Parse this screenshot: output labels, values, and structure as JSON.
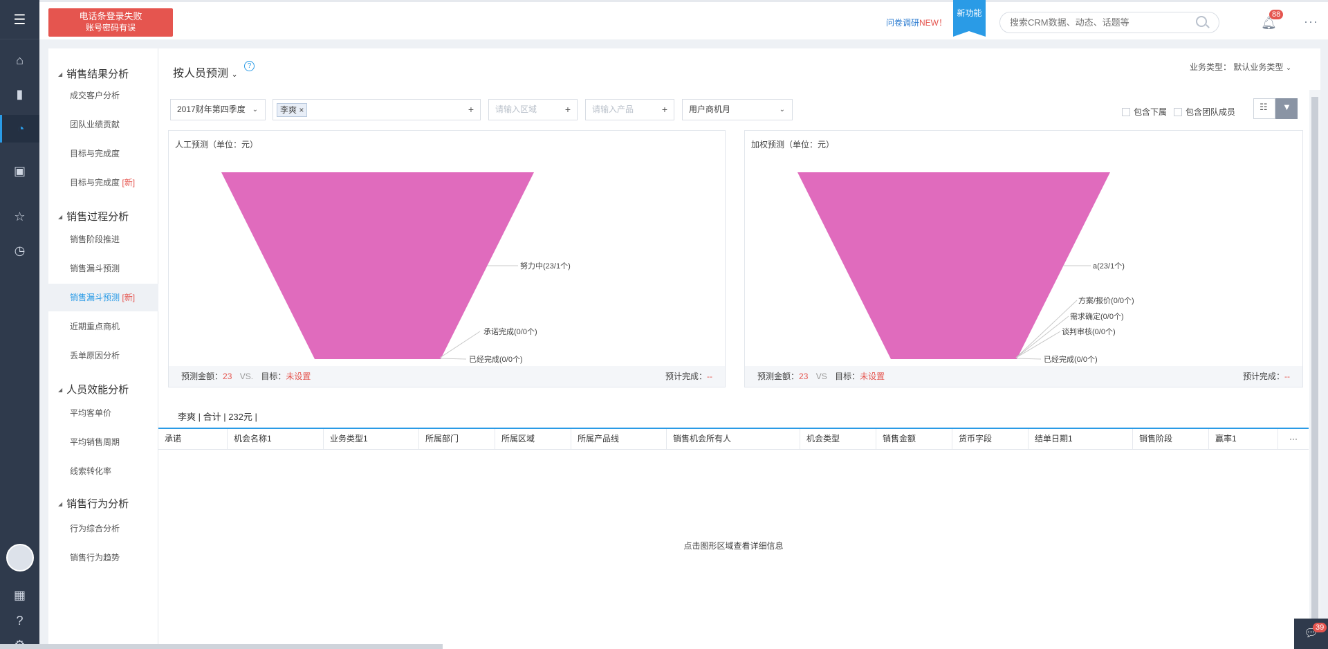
{
  "rail": {
    "icons": [
      "menu-icon",
      "home-icon",
      "bar-chart-icon",
      "pie-chart-icon",
      "monitor-icon",
      "star-icon",
      "history-icon",
      "grid-icon",
      "help-icon",
      "gear-icon"
    ]
  },
  "topbar": {
    "alert_line1": "电话条登录失败",
    "alert_line2": "账号密码有误",
    "survey": "问卷调研",
    "survey_new": "NEW！",
    "new_feature": "新功能",
    "search_placeholder": "搜索CRM数据、动态、话题等",
    "notifications": "88",
    "more": "···"
  },
  "sidebar": {
    "groups": [
      {
        "label": "销售结果分析",
        "items": [
          {
            "label": "成交客户分析"
          },
          {
            "label": "团队业绩贡献"
          },
          {
            "label": "目标与完成度"
          },
          {
            "label": "目标与完成度",
            "tag": "[新]"
          }
        ]
      },
      {
        "label": "销售过程分析",
        "items": [
          {
            "label": "销售阶段推进"
          },
          {
            "label": "销售漏斗预测"
          },
          {
            "label": "销售漏斗预测",
            "tag": "[新]",
            "active": true
          },
          {
            "label": "近期重点商机"
          },
          {
            "label": "丢单原因分析"
          }
        ]
      },
      {
        "label": "人员效能分析",
        "items": [
          {
            "label": "平均客单价"
          },
          {
            "label": "平均销售周期"
          },
          {
            "label": "线索转化率"
          }
        ]
      },
      {
        "label": "销售行为分析",
        "items": [
          {
            "label": "行为综合分析"
          },
          {
            "label": "销售行为趋势"
          }
        ]
      }
    ]
  },
  "main": {
    "title": "按人员预测",
    "biz_type_label": "业务类型：",
    "biz_type_value": "默认业务类型",
    "filters": {
      "period": "2017财年第四季度",
      "person_chip": "李爽",
      "region_placeholder": "请输入区域",
      "product_placeholder": "请输入产品",
      "month_mode": "用户商机月"
    },
    "checkboxes": {
      "include_sub": "包含下属",
      "include_team": "包含团队成员"
    },
    "panels": [
      {
        "title": "人工预测（单位：元）",
        "labels": [
          "努力中(23/1个)",
          "承诺完成(0/0个)",
          "已经完成(0/0个)"
        ],
        "foot_amount_label": "预测金额：",
        "foot_amount": "23",
        "foot_vs": "VS.",
        "foot_target_label": "目标：",
        "foot_target": "未设置",
        "foot_expected_label": "预计完成：",
        "foot_expected": "--"
      },
      {
        "title": "加权预测（单位：元）",
        "labels": [
          "a(23/1个)",
          "方案/报价(0/0个)",
          "需求确定(0/0个)",
          "谈判审核(0/0个)",
          "已经完成(0/0个)"
        ],
        "foot_amount_label": "预测金额：",
        "foot_amount": "23",
        "foot_vs": "VS",
        "foot_target_label": "目标：",
        "foot_target": "未设置",
        "foot_expected_label": "预计完成：",
        "foot_expected": "--"
      }
    ],
    "funnel_color": "#e06bbd",
    "summary": "李爽 | 合计 | 232元 |",
    "columns": [
      "承诺",
      "机会名称1",
      "业务类型1",
      "所属部门",
      "所属区域",
      "所属产品线",
      "销售机会所有人",
      "机会类型",
      "销售金额",
      "货币字段",
      "结单日期1",
      "销售阶段",
      "赢率1"
    ],
    "empty_hint": "点击图形区域查看详细信息",
    "chat_badge": "39"
  },
  "colors": {
    "accent": "#2a9be6",
    "alert": "#e5554f",
    "rail": "#2f3a4c"
  }
}
